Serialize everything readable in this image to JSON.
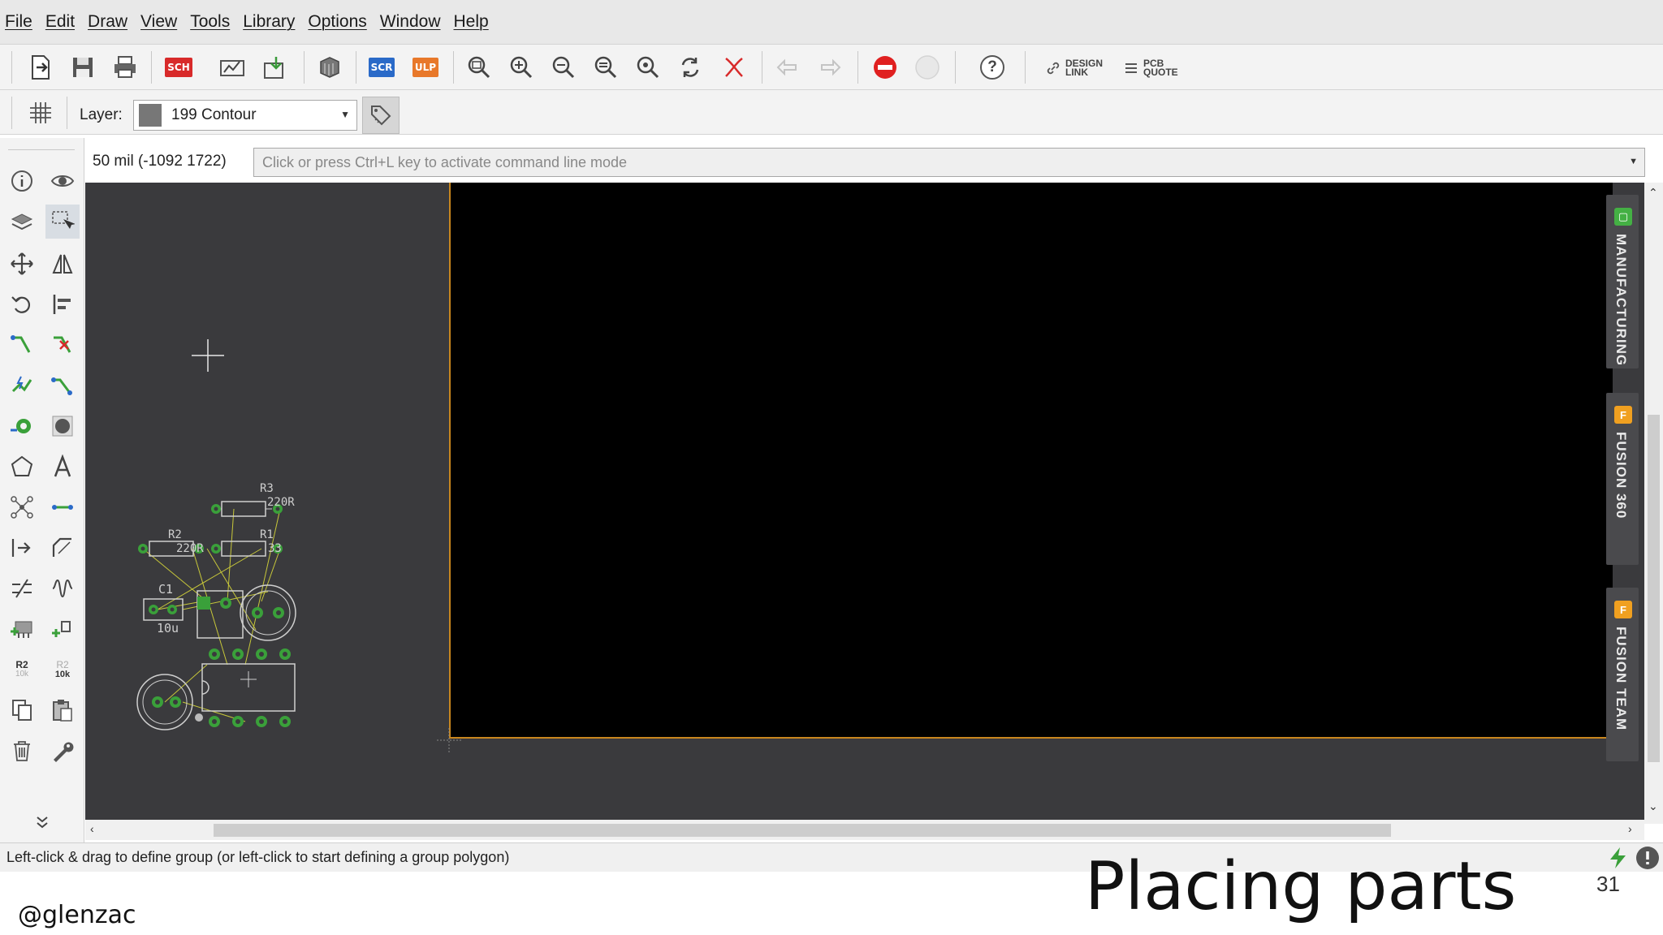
{
  "menu": {
    "items": [
      "File",
      "Edit",
      "Draw",
      "View",
      "Tools",
      "Library",
      "Options",
      "Window",
      "Help"
    ]
  },
  "toolbar": {
    "sch_label": "SCH",
    "scr_label": "SCR",
    "ulp_label": "ULP",
    "design_link": [
      "DESIGN",
      "LINK"
    ],
    "pcb_quote": [
      "PCB",
      "QUOTE"
    ],
    "help_glyph": "?"
  },
  "layer": {
    "label": "Layer:",
    "value": "199 Contour",
    "swatch_color": "#777777"
  },
  "left_tools": {
    "r2_label": "R2",
    "r2_value": "10k"
  },
  "command": {
    "coordinates": "50 mil (-1092 1722)",
    "placeholder": "Click or press Ctrl+L key to activate command line mode"
  },
  "canvas": {
    "background": "#3a3a3d",
    "board_outline_color": "#c8861e",
    "part_labels": {
      "r3": "R3",
      "r3_value": "220R",
      "r2": "R2",
      "r2_value": "220R",
      "r1": "R1",
      "r1_value": "33",
      "c1": "C1",
      "c1_value": "10u"
    }
  },
  "side_tabs": [
    {
      "label": "MANUFACTURING",
      "icon_color": "#44b044"
    },
    {
      "label": "FUSION 360",
      "icon_color": "#f0a020"
    },
    {
      "label": "FUSION TEAM",
      "icon_color": "#f0a020"
    }
  ],
  "status": {
    "text": "Left-click & drag to define group (or left-click to start defining a group polygon)"
  },
  "slide": {
    "handle": "@glenzac",
    "title": "Placing parts",
    "page_number": "31"
  }
}
